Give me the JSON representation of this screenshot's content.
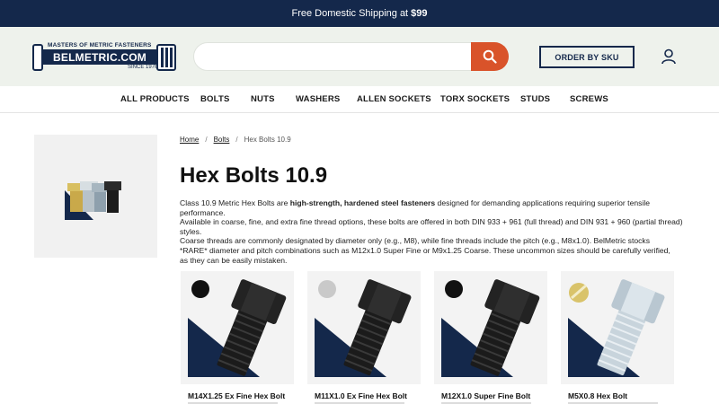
{
  "promo": {
    "text": "Free Domestic Shipping at",
    "amount": "$99"
  },
  "logo": {
    "tagline": "MASTERS OF METRIC FASTENERS",
    "name": "BELMETRIC.COM",
    "since": "SINCE 1976®"
  },
  "search": {
    "value": "",
    "placeholder": ""
  },
  "header": {
    "sku_button": "ORDER BY SKU"
  },
  "nav": [
    "ALL PRODUCTS",
    "BOLTS",
    "NUTS",
    "WASHERS",
    "ALLEN SOCKETS",
    "TORX SOCKETS",
    "STUDS",
    "SCREWS"
  ],
  "breadcrumb": {
    "home": "Home",
    "bolts": "Bolts",
    "current": "Hex Bolts 10.9"
  },
  "page": {
    "title": "Hex Bolts 10.9",
    "p1_pre": "Class 10.9 Metric Hex Bolts are ",
    "p1_bold": "high-strength, hardened steel fasteners",
    "p1_post": " designed for demanding applications requiring superior tensile performance.",
    "p2": "Available in coarse, fine, and extra fine thread options, these bolts are offered in both DIN 933 + 961 (full thread) and DIN 931 + 960 (partial thread) styles.",
    "p3": "Coarse threads are commonly designated by diameter only (e.g., M8), while fine threads include the pitch (e.g., M8x1.0). BelMetric stocks *RARE* diameter and pitch combinations such as M12x1.0 Super Fine or M9x1.25 Coarse. These uncommon sizes should be carefully verified, as they can be easily mistaken."
  },
  "products": [
    {
      "name": "M14X1.25 Ex Fine Hex Bolt",
      "finish": "black",
      "finish_color": "#111111"
    },
    {
      "name": "M11X1.0 Ex Fine Hex Bolt",
      "finish": "plain",
      "finish_color": "#c9c9c9"
    },
    {
      "name": "M12X1.0 Super Fine Bolt",
      "finish": "black",
      "finish_color": "#111111"
    },
    {
      "name": "M5X0.8 Hex Bolt",
      "finish": "zinc",
      "finish_color": "#d9c36a"
    }
  ],
  "colors": {
    "navy": "#14284b",
    "accent": "#d9532a",
    "header_bg": "#eef2ec"
  }
}
